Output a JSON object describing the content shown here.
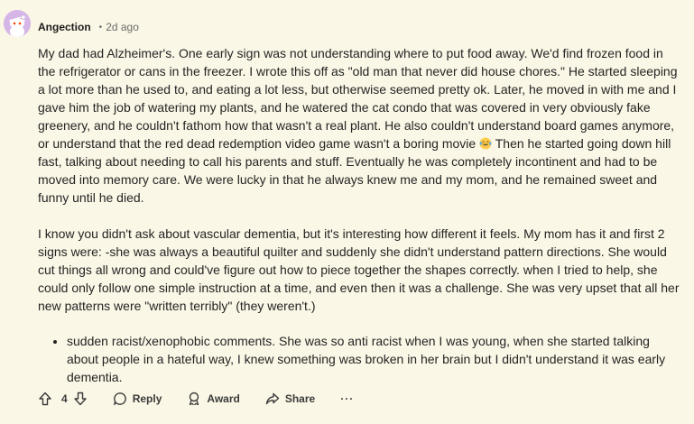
{
  "comment": {
    "username": "Angection",
    "separator": "•",
    "timestamp": "2d ago",
    "avatar_color": "#d6b6e6",
    "paragraph1_part1": "My dad had Alzheimer's. One early sign was not understanding where to put food away. We'd find frozen food in the refrigerator or cans in the freezer. I wrote this off as \"old man that never did house chores.\" He started sleeping a lot more than he used to, and eating a lot less, but otherwise seemed pretty ok. Later, he moved in with me and I gave him the job of watering my plants, and he watered the cat condo that was covered in very obviously fake greenery, and he couldn't fathom how that wasn't a real plant. He also couldn't understand board games anymore, or understand that the red dead redemption video game wasn't a boring movie ",
    "paragraph1_emoji": "laughing-crying-emoji",
    "paragraph1_part2": " Then he started going down hill fast, talking about needing to call his parents and stuff. Eventually he was completely incontinent and had to be moved into memory care. We were lucky in that he always knew me and my mom, and he remained sweet and funny until he died.",
    "paragraph2": "I know you didn't ask about vascular dementia, but it's interesting how different it feels. My mom has it and first 2 signs were: -she was always a beautiful quilter and suddenly she didn't understand pattern directions. She would cut things all wrong and could've figure out how to piece together the shapes correctly. when I tried to help, she could only follow one simple instruction at a time, and even then it was a challenge. She was very upset that all her new patterns were \"written terribly\" (they weren't.)",
    "bullets": [
      "sudden racist/xenophobic comments. She was so anti racist when I was young, when she started talking about people in a hateful way, I knew something was broken in her brain but I didn't understand it was early dementia."
    ]
  },
  "actions": {
    "upvote_icon": "upvote-arrow-icon",
    "vote_count": "4",
    "downvote_icon": "downvote-arrow-icon",
    "reply_label": "Reply",
    "award_label": "Award",
    "share_label": "Share",
    "more_label": "···"
  }
}
